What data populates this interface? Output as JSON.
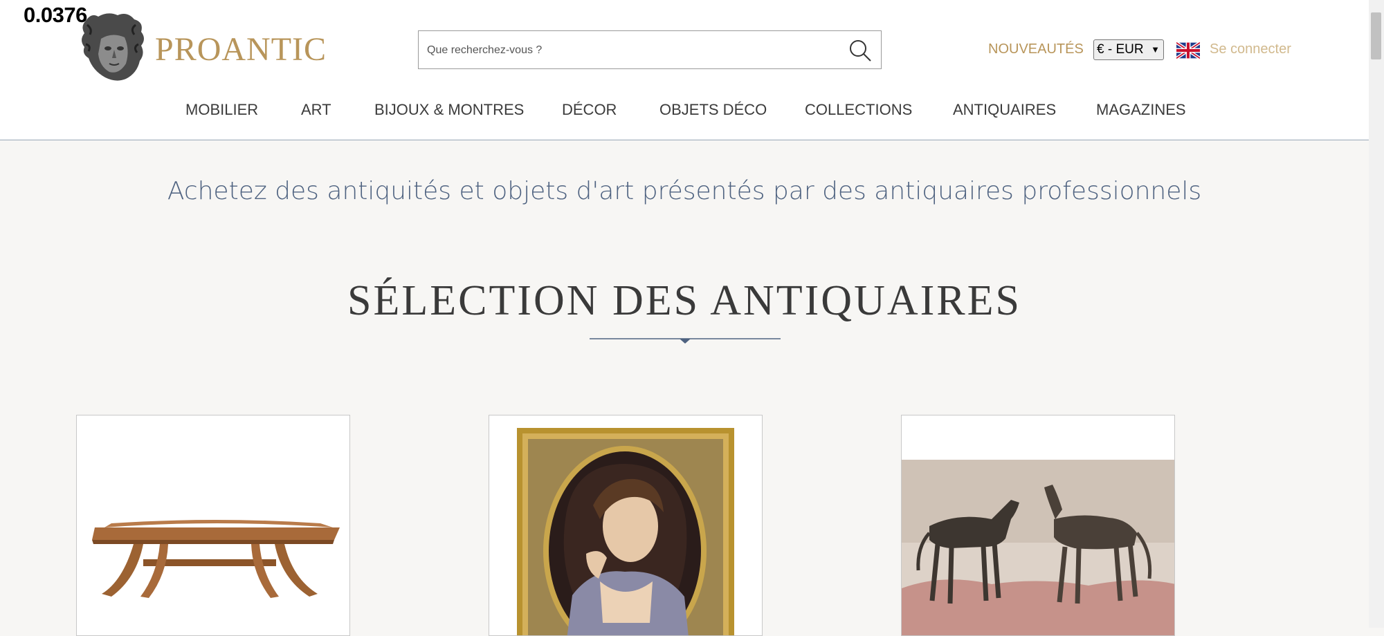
{
  "overlay": {
    "value": "0.0376"
  },
  "header": {
    "logo_text": "PROANTIC",
    "search_placeholder": "Que recherchez-vous ?",
    "nouveautes": "NOUVEAUTÉS",
    "currency": "€ - EUR",
    "login": "Se connecter"
  },
  "nav": {
    "items": [
      {
        "label": "MOBILIER"
      },
      {
        "label": "ART"
      },
      {
        "label": "BIJOUX & MONTRES"
      },
      {
        "label": "DÉCOR"
      },
      {
        "label": "OBJETS DÉCO"
      },
      {
        "label": "COLLECTIONS"
      },
      {
        "label": "ANTIQUAIRES"
      },
      {
        "label": "MAGAZINES"
      }
    ]
  },
  "main": {
    "tagline": "Achetez des antiquités et objets d'art présentés par des antiquaires professionnels",
    "section_title": "SÉLECTION DES ANTIQUAIRES"
  },
  "colors": {
    "gold": "#b8955a",
    "tagline_blue": "#4e6280",
    "background": "#f7f6f4"
  }
}
